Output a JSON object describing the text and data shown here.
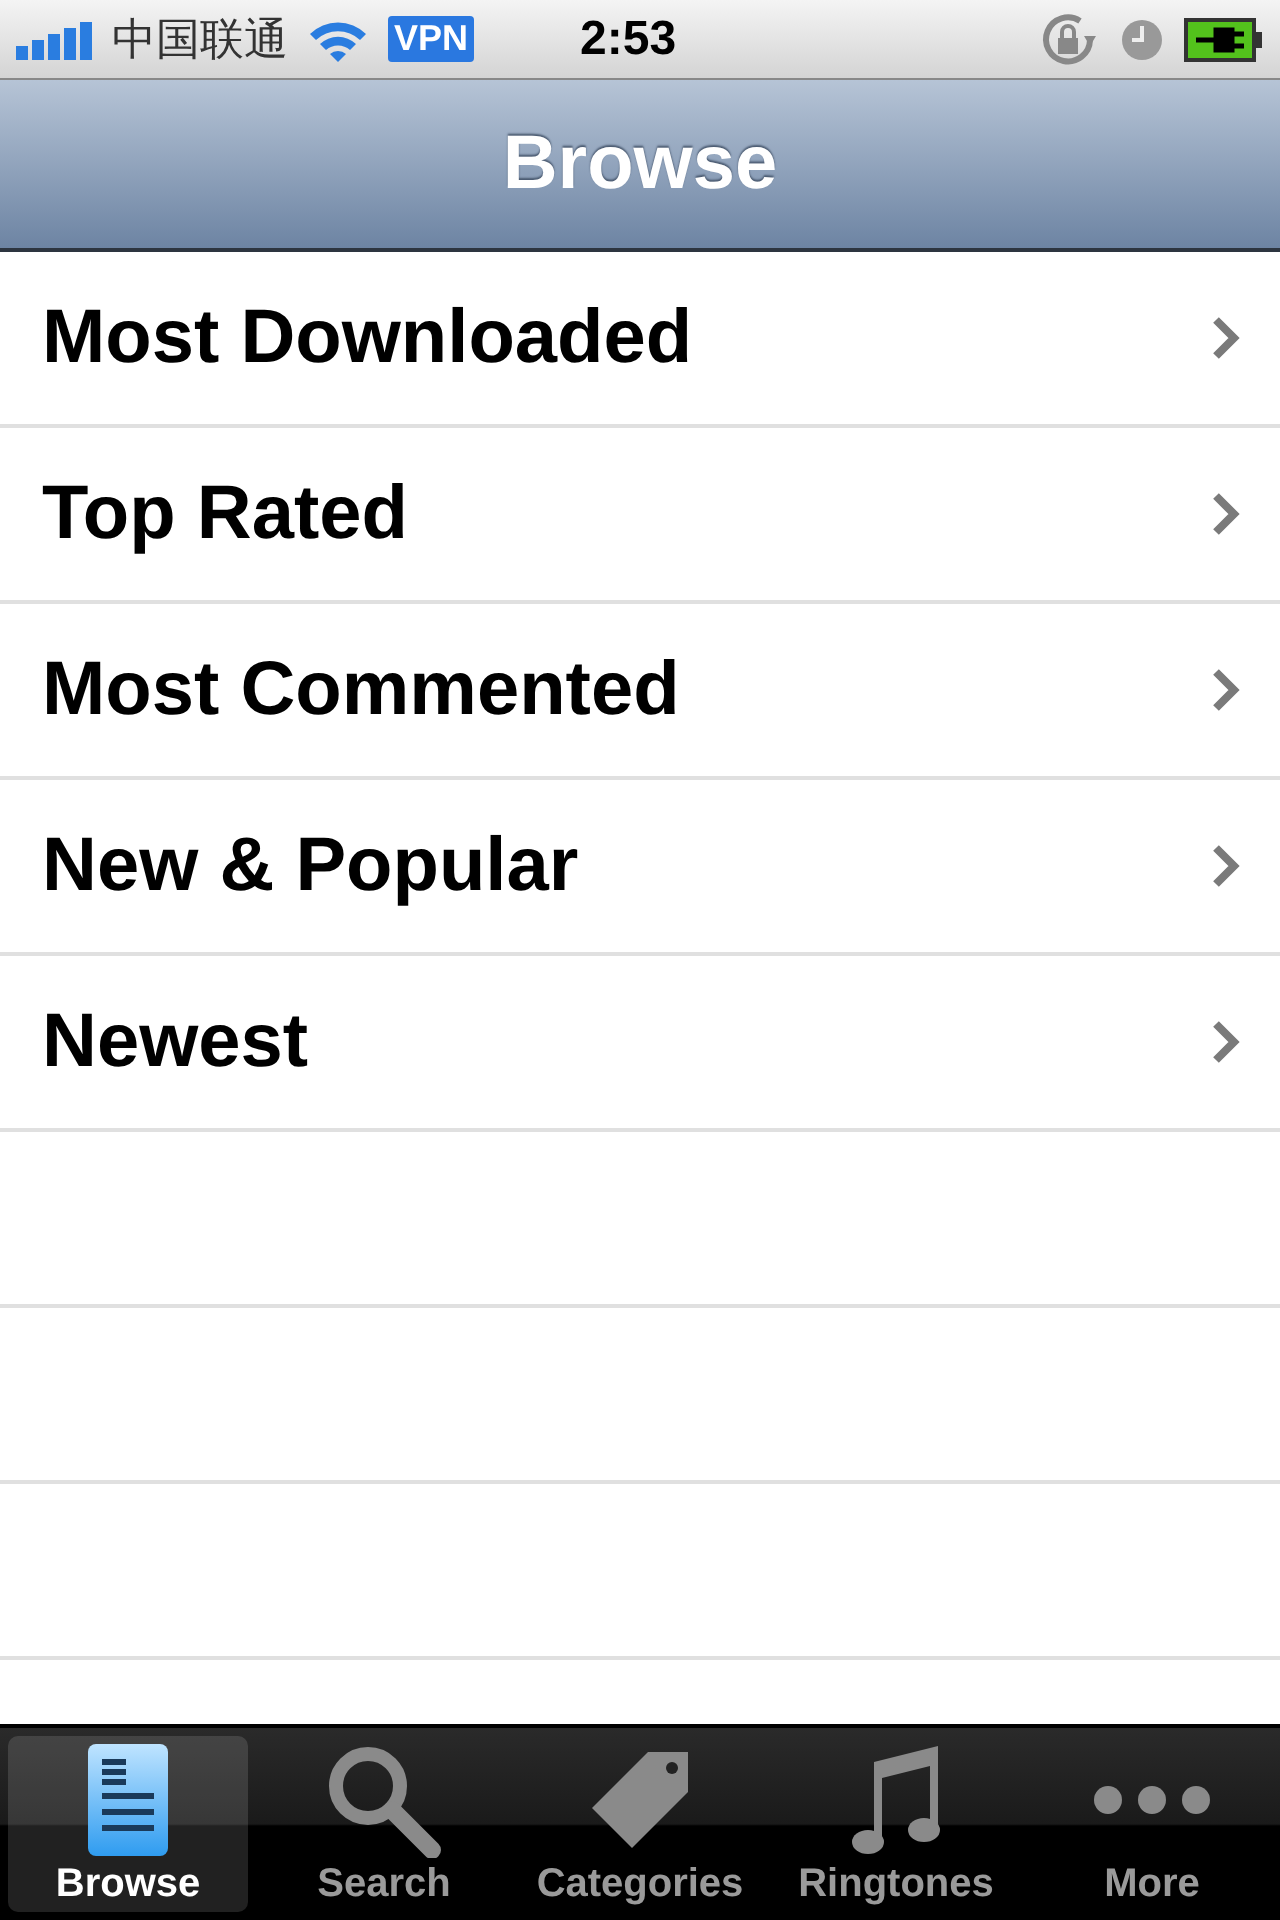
{
  "status_bar": {
    "carrier": "中国联通",
    "vpn": "VPN",
    "time": "2:53"
  },
  "nav_bar": {
    "title": "Browse"
  },
  "items": [
    {
      "label": "Most Downloaded"
    },
    {
      "label": "Top Rated"
    },
    {
      "label": "Most Commented"
    },
    {
      "label": "New & Popular"
    },
    {
      "label": "Newest"
    }
  ],
  "tabs": [
    {
      "label": "Browse",
      "kind": "document",
      "selected": true
    },
    {
      "label": "Search",
      "kind": "search",
      "selected": false
    },
    {
      "label": "Categories",
      "kind": "tag",
      "selected": false
    },
    {
      "label": "Ringtones",
      "kind": "music",
      "selected": false
    },
    {
      "label": "More",
      "kind": "more",
      "selected": false
    }
  ]
}
